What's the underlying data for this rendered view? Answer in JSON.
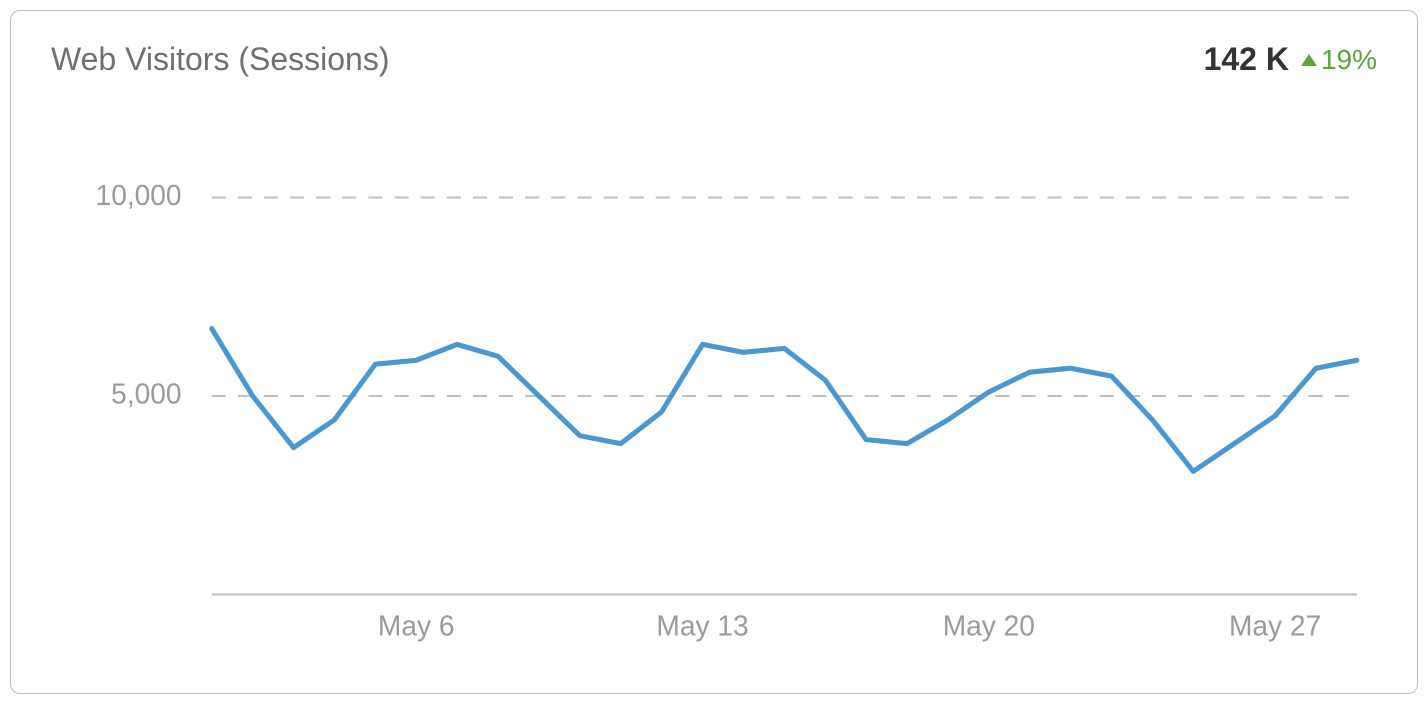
{
  "title": "Web Visitors (Sessions)",
  "metric": {
    "value": "142 K",
    "trend_direction": "up",
    "trend_pct": "19%"
  },
  "colors": {
    "line": "#4a97d2",
    "trend_up": "#5aa63a",
    "text_muted": "#9b9b9b"
  },
  "chart_data": {
    "type": "line",
    "title": "Web Visitors (Sessions)",
    "xlabel": "",
    "ylabel": "",
    "ylim": [
      0,
      12000
    ],
    "y_ticks": [
      5000,
      10000
    ],
    "y_tick_labels": [
      "5,000",
      "10,000"
    ],
    "x_tick_labels": [
      "May 6",
      "May 13",
      "May 20",
      "May 27"
    ],
    "x_tick_indices": [
      5,
      12,
      19,
      26
    ],
    "categories": [
      "May 1",
      "May 2",
      "May 3",
      "May 4",
      "May 5",
      "May 6",
      "May 7",
      "May 8",
      "May 9",
      "May 10",
      "May 11",
      "May 12",
      "May 13",
      "May 14",
      "May 15",
      "May 16",
      "May 17",
      "May 18",
      "May 19",
      "May 20",
      "May 21",
      "May 22",
      "May 23",
      "May 24",
      "May 25",
      "May 26",
      "May 27",
      "May 28",
      "May 29"
    ],
    "values": [
      6700,
      5000,
      3700,
      4400,
      5800,
      5900,
      6300,
      6000,
      5000,
      4000,
      3800,
      4600,
      6300,
      6100,
      6200,
      5400,
      3900,
      3800,
      4400,
      5100,
      5600,
      5700,
      5500,
      4400,
      3100,
      3800,
      4500,
      5700,
      5900
    ]
  }
}
